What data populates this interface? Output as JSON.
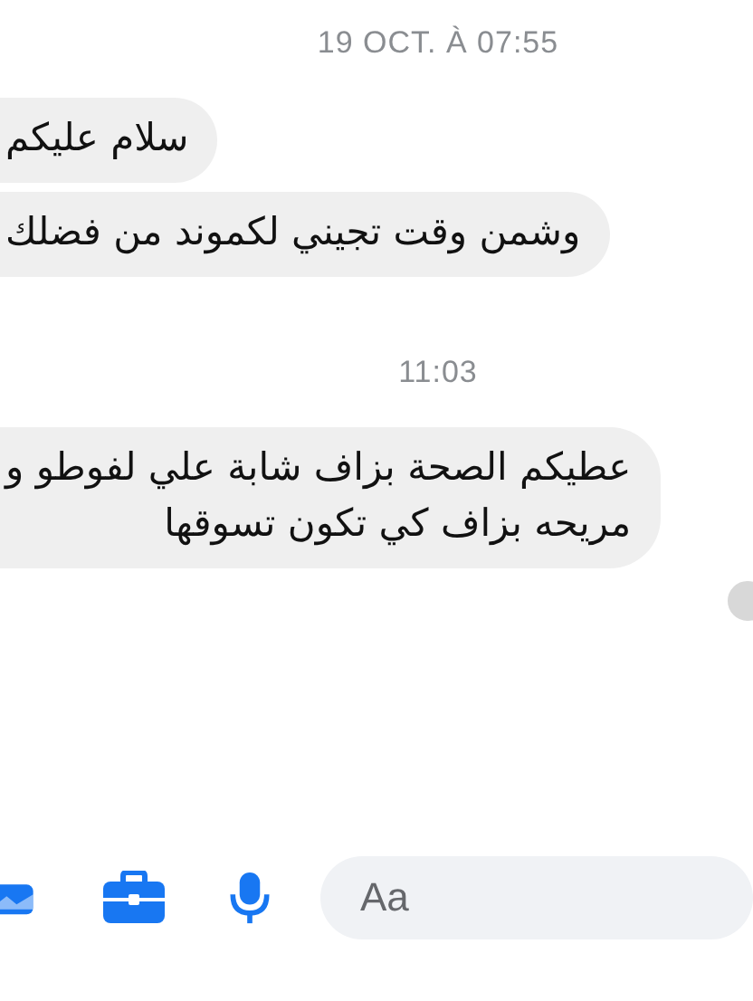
{
  "conversation": [
    {
      "kind": "timestamp",
      "text": "19 OCT. À 07:55"
    },
    {
      "kind": "message",
      "lines": [
        "سلام عليكم"
      ]
    },
    {
      "kind": "message",
      "lines": [
        "وشمن وقت تجيني لكموند من فضلك"
      ]
    },
    {
      "kind": "timestamp",
      "text": "11:03"
    },
    {
      "kind": "message",
      "lines": [
        "عطيكم الصحة بزاف شابة علي لفوطو و",
        "مريحه بزاف كي تكون تسوقها"
      ]
    }
  ],
  "composer": {
    "placeholder": "Aa"
  }
}
